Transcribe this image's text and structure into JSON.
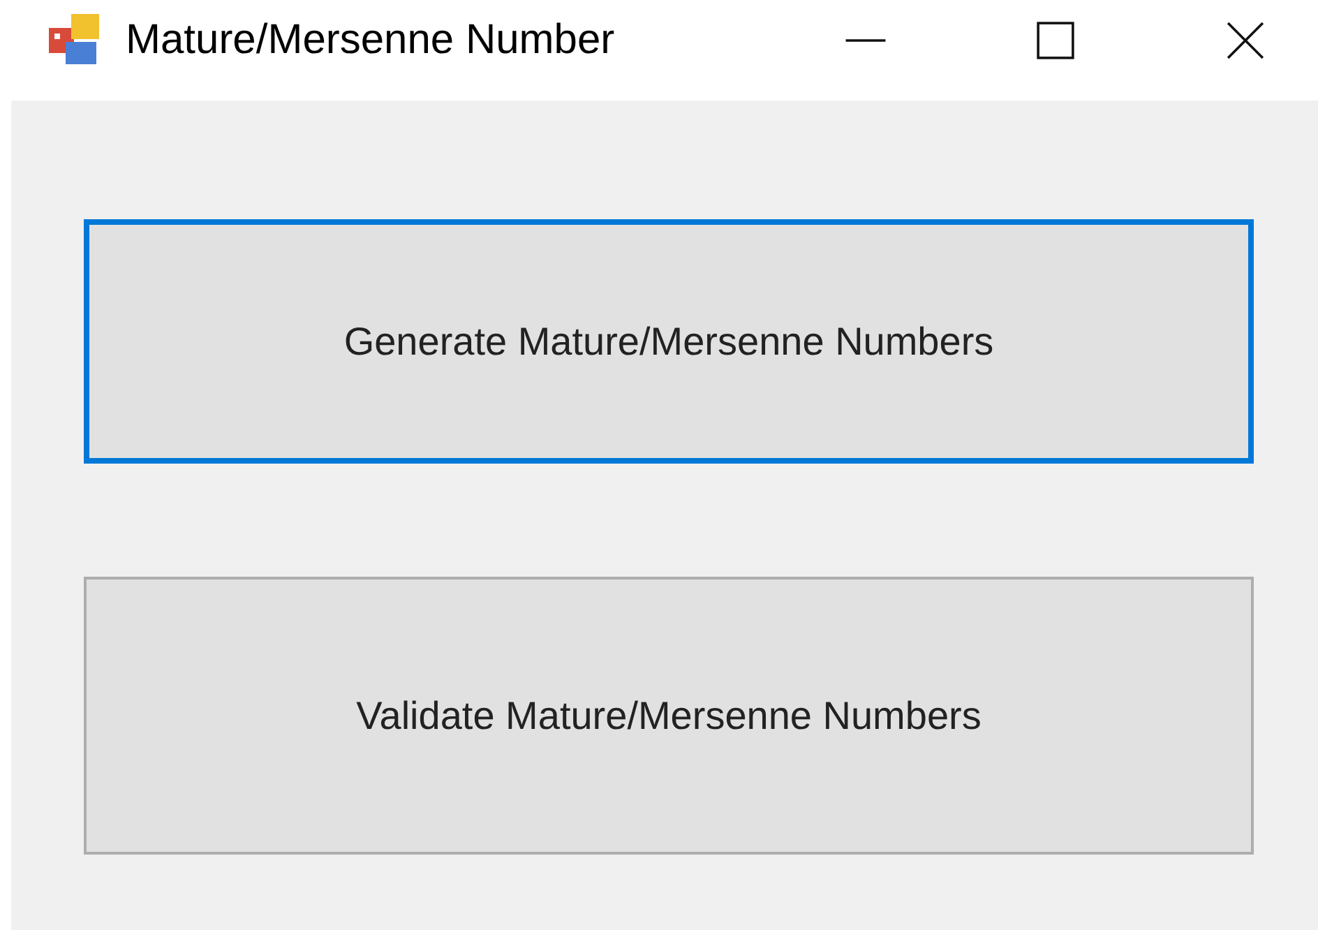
{
  "window": {
    "title": "Mature/Mersenne Number"
  },
  "buttons": [
    {
      "label": "Generate Mature/Mersenne Numbers",
      "focused": true
    },
    {
      "label": "Validate Mature/Mersenne Numbers",
      "focused": false
    }
  ]
}
